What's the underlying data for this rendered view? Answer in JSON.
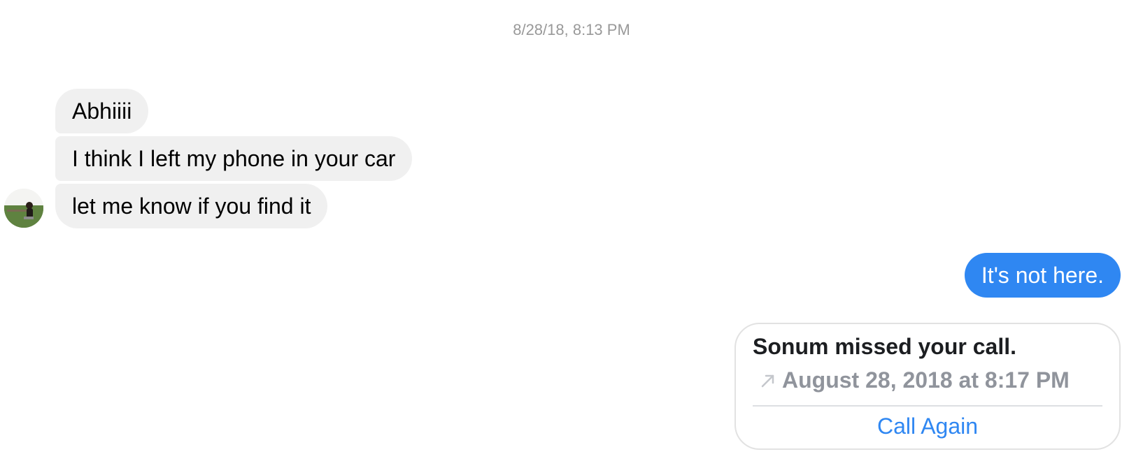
{
  "conversation": {
    "timestamp": "8/28/18, 8:13 PM",
    "incoming_messages": [
      {
        "text": "Abhiiii"
      },
      {
        "text": "I think I left my phone in your car"
      },
      {
        "text": "let me know if you find it"
      }
    ],
    "outgoing_messages": [
      {
        "text": "It's not here."
      }
    ],
    "call_card": {
      "title": "Sonum missed your call.",
      "time": "August 28, 2018 at 8:17 PM",
      "direction_icon": "outgoing-call-arrow-icon",
      "action_label": "Call Again"
    }
  },
  "colors": {
    "incoming_bubble": "#f0f0f0",
    "outgoing_bubble": "#2f87f2",
    "link": "#2f87f2",
    "muted_text": "#90949c"
  }
}
